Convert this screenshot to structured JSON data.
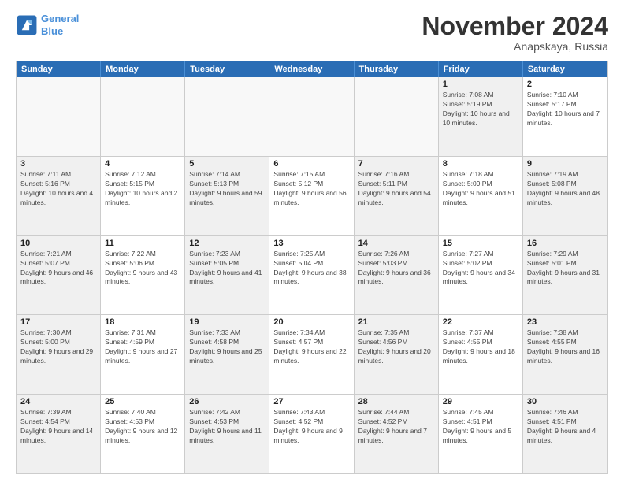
{
  "logo": {
    "line1": "General",
    "line2": "Blue"
  },
  "title": "November 2024",
  "subtitle": "Anapskaya, Russia",
  "days_of_week": [
    "Sunday",
    "Monday",
    "Tuesday",
    "Wednesday",
    "Thursday",
    "Friday",
    "Saturday"
  ],
  "weeks": [
    {
      "cells": [
        {
          "day": "",
          "empty": true
        },
        {
          "day": "",
          "empty": true
        },
        {
          "day": "",
          "empty": true
        },
        {
          "day": "",
          "empty": true
        },
        {
          "day": "",
          "empty": true
        },
        {
          "day": "1",
          "info": "Sunrise: 7:08 AM\nSunset: 5:19 PM\nDaylight: 10 hours and 10 minutes.",
          "shaded": true
        },
        {
          "day": "2",
          "info": "Sunrise: 7:10 AM\nSunset: 5:17 PM\nDaylight: 10 hours and 7 minutes.",
          "shaded": false
        }
      ]
    },
    {
      "cells": [
        {
          "day": "3",
          "info": "Sunrise: 7:11 AM\nSunset: 5:16 PM\nDaylight: 10 hours and 4 minutes.",
          "shaded": true
        },
        {
          "day": "4",
          "info": "Sunrise: 7:12 AM\nSunset: 5:15 PM\nDaylight: 10 hours and 2 minutes.",
          "shaded": false
        },
        {
          "day": "5",
          "info": "Sunrise: 7:14 AM\nSunset: 5:13 PM\nDaylight: 9 hours and 59 minutes.",
          "shaded": true
        },
        {
          "day": "6",
          "info": "Sunrise: 7:15 AM\nSunset: 5:12 PM\nDaylight: 9 hours and 56 minutes.",
          "shaded": false
        },
        {
          "day": "7",
          "info": "Sunrise: 7:16 AM\nSunset: 5:11 PM\nDaylight: 9 hours and 54 minutes.",
          "shaded": true
        },
        {
          "day": "8",
          "info": "Sunrise: 7:18 AM\nSunset: 5:09 PM\nDaylight: 9 hours and 51 minutes.",
          "shaded": false
        },
        {
          "day": "9",
          "info": "Sunrise: 7:19 AM\nSunset: 5:08 PM\nDaylight: 9 hours and 48 minutes.",
          "shaded": true
        }
      ]
    },
    {
      "cells": [
        {
          "day": "10",
          "info": "Sunrise: 7:21 AM\nSunset: 5:07 PM\nDaylight: 9 hours and 46 minutes.",
          "shaded": true
        },
        {
          "day": "11",
          "info": "Sunrise: 7:22 AM\nSunset: 5:06 PM\nDaylight: 9 hours and 43 minutes.",
          "shaded": false
        },
        {
          "day": "12",
          "info": "Sunrise: 7:23 AM\nSunset: 5:05 PM\nDaylight: 9 hours and 41 minutes.",
          "shaded": true
        },
        {
          "day": "13",
          "info": "Sunrise: 7:25 AM\nSunset: 5:04 PM\nDaylight: 9 hours and 38 minutes.",
          "shaded": false
        },
        {
          "day": "14",
          "info": "Sunrise: 7:26 AM\nSunset: 5:03 PM\nDaylight: 9 hours and 36 minutes.",
          "shaded": true
        },
        {
          "day": "15",
          "info": "Sunrise: 7:27 AM\nSunset: 5:02 PM\nDaylight: 9 hours and 34 minutes.",
          "shaded": false
        },
        {
          "day": "16",
          "info": "Sunrise: 7:29 AM\nSunset: 5:01 PM\nDaylight: 9 hours and 31 minutes.",
          "shaded": true
        }
      ]
    },
    {
      "cells": [
        {
          "day": "17",
          "info": "Sunrise: 7:30 AM\nSunset: 5:00 PM\nDaylight: 9 hours and 29 minutes.",
          "shaded": true
        },
        {
          "day": "18",
          "info": "Sunrise: 7:31 AM\nSunset: 4:59 PM\nDaylight: 9 hours and 27 minutes.",
          "shaded": false
        },
        {
          "day": "19",
          "info": "Sunrise: 7:33 AM\nSunset: 4:58 PM\nDaylight: 9 hours and 25 minutes.",
          "shaded": true
        },
        {
          "day": "20",
          "info": "Sunrise: 7:34 AM\nSunset: 4:57 PM\nDaylight: 9 hours and 22 minutes.",
          "shaded": false
        },
        {
          "day": "21",
          "info": "Sunrise: 7:35 AM\nSunset: 4:56 PM\nDaylight: 9 hours and 20 minutes.",
          "shaded": true
        },
        {
          "day": "22",
          "info": "Sunrise: 7:37 AM\nSunset: 4:55 PM\nDaylight: 9 hours and 18 minutes.",
          "shaded": false
        },
        {
          "day": "23",
          "info": "Sunrise: 7:38 AM\nSunset: 4:55 PM\nDaylight: 9 hours and 16 minutes.",
          "shaded": true
        }
      ]
    },
    {
      "cells": [
        {
          "day": "24",
          "info": "Sunrise: 7:39 AM\nSunset: 4:54 PM\nDaylight: 9 hours and 14 minutes.",
          "shaded": true
        },
        {
          "day": "25",
          "info": "Sunrise: 7:40 AM\nSunset: 4:53 PM\nDaylight: 9 hours and 12 minutes.",
          "shaded": false
        },
        {
          "day": "26",
          "info": "Sunrise: 7:42 AM\nSunset: 4:53 PM\nDaylight: 9 hours and 11 minutes.",
          "shaded": true
        },
        {
          "day": "27",
          "info": "Sunrise: 7:43 AM\nSunset: 4:52 PM\nDaylight: 9 hours and 9 minutes.",
          "shaded": false
        },
        {
          "day": "28",
          "info": "Sunrise: 7:44 AM\nSunset: 4:52 PM\nDaylight: 9 hours and 7 minutes.",
          "shaded": true
        },
        {
          "day": "29",
          "info": "Sunrise: 7:45 AM\nSunset: 4:51 PM\nDaylight: 9 hours and 5 minutes.",
          "shaded": false
        },
        {
          "day": "30",
          "info": "Sunrise: 7:46 AM\nSunset: 4:51 PM\nDaylight: 9 hours and 4 minutes.",
          "shaded": true
        }
      ]
    }
  ]
}
